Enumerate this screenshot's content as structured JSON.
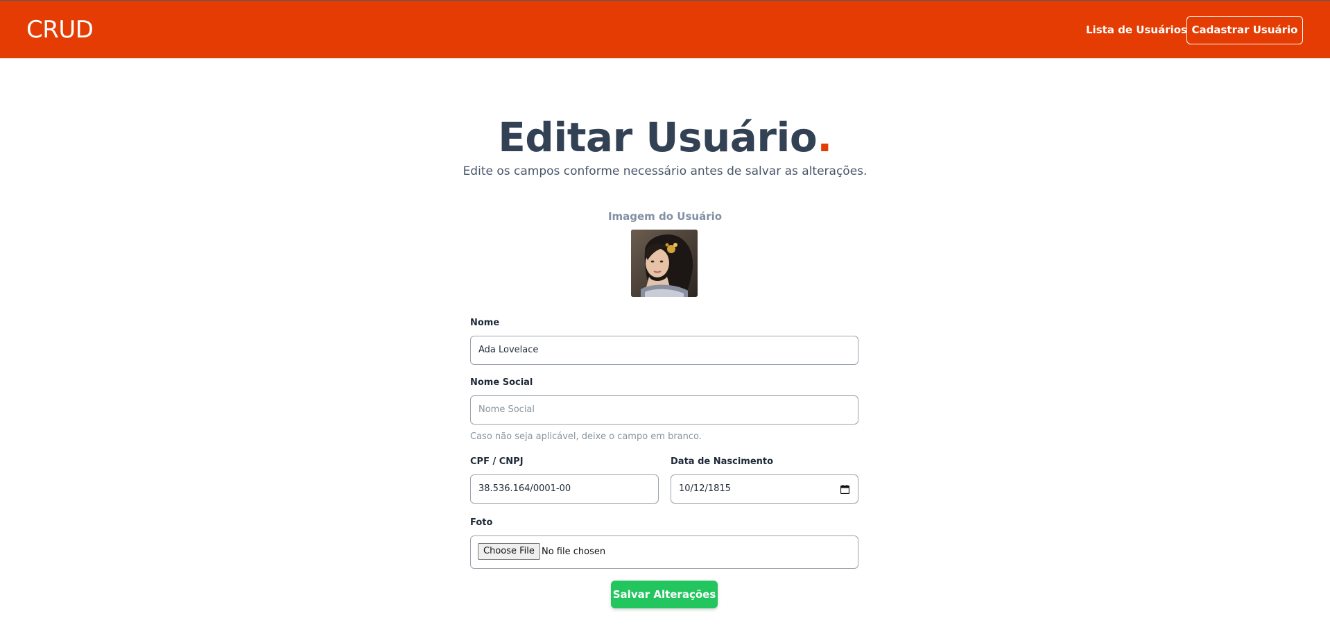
{
  "navbar": {
    "brand": "CRUD",
    "link_list": "Lista de Usuários",
    "button_register": "Cadastrar Usuário",
    "background": "#e43c03"
  },
  "page": {
    "title": "Editar Usuário",
    "title_dot": ".",
    "subtitle": "Edite os campos conforme necessário antes de salvar as alterações.",
    "image_label": "Imagem do Usuário",
    "avatar_alt": "Ada Lovelace portrait"
  },
  "form": {
    "nome": {
      "label": "Nome",
      "value": "Ada Lovelace"
    },
    "nome_social": {
      "label": "Nome Social",
      "placeholder": "Nome Social",
      "help": "Caso não seja aplicável, deixe o campo em branco."
    },
    "cpf": {
      "label": "CPF / CNPJ",
      "value": "38.536.164/0001-00"
    },
    "nascimento": {
      "label": "Data de Nascimento",
      "value": "10/12/1815",
      "icon": "calendar-icon"
    },
    "foto": {
      "label": "Foto",
      "button": "Choose File",
      "status": "No file chosen"
    },
    "submit": "Salvar Alterações",
    "submit_color": "#22c55e"
  }
}
